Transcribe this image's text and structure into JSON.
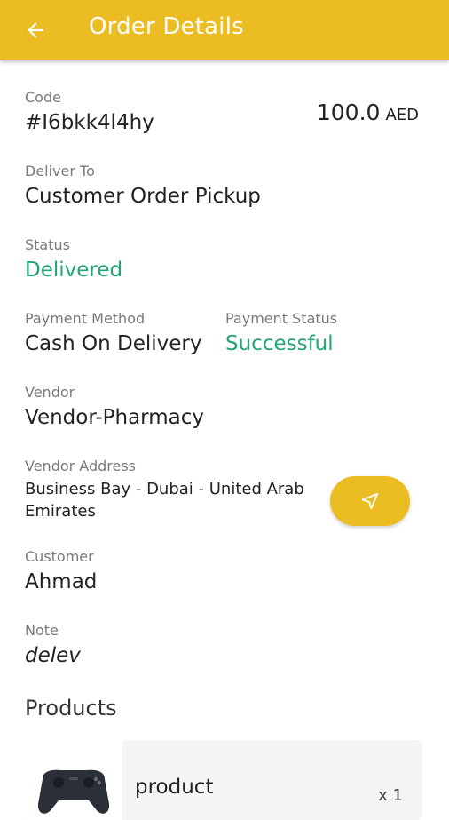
{
  "appbar": {
    "title": "Order Details",
    "back_icon": "arrow-left-icon"
  },
  "order": {
    "code_label": "Code",
    "code": "#I6bkk4l4hy",
    "amount": "100.0",
    "currency": "AED",
    "deliver_to_label": "Deliver To",
    "deliver_to": "Customer Order Pickup",
    "status_label": "Status",
    "status": "Delivered",
    "payment_method_label": "Payment Method",
    "payment_method": "Cash On Delivery",
    "payment_status_label": "Payment Status",
    "payment_status": "Successful",
    "vendor_label": "Vendor",
    "vendor": "Vendor-Pharmacy",
    "vendor_address_label": "Vendor Address",
    "vendor_address": "Business Bay - Dubai - United Arab Emirates",
    "customer_label": "Customer",
    "customer": "Ahmad",
    "note_label": "Note",
    "note": "delev"
  },
  "products": {
    "title": "Products",
    "items": [
      {
        "name": "product",
        "qty": "x 1",
        "thumbnail": "gamepad-image"
      }
    ]
  },
  "colors": {
    "accent": "#ecbd23",
    "success": "#21a67a"
  }
}
